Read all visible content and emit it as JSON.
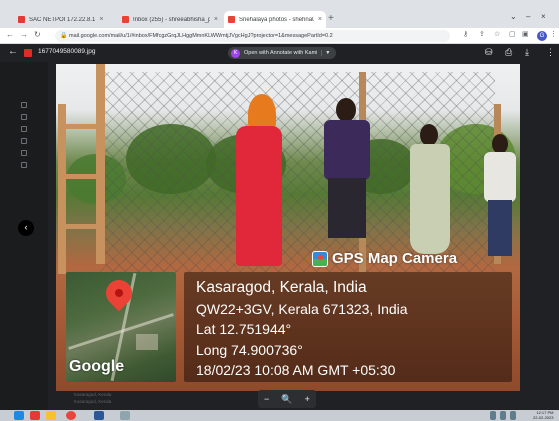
{
  "browser": {
    "tabs": [
      {
        "title": "SAC NETPOI   172.22.8.1",
        "favicon_color": "#e53935"
      },
      {
        "title": "Inbox (255) - shreeabhisha_ponam",
        "favicon_color": "#ea4335"
      },
      {
        "title": "Snehalaya photos - shehna09@g",
        "favicon_color": "#ea4335"
      }
    ],
    "new_tab": "+",
    "address": "mail.google.com/mail/u/1/#inbox/FMfcgzGrqJLHggMmnKLWWmtjJVgcHgJ?projector=1&messagePartId=0.2",
    "profile_initial": "G"
  },
  "viewer": {
    "filename": "1677049580089.jpg",
    "open_with": "Open with Annotate with Kami",
    "open_with_icon": "K"
  },
  "photo": {
    "header": "GPS Map Camera",
    "map_logo": "Google",
    "location": "Kasaragod, Kerala, India",
    "plus_code": "QW22+3GV, Kerala 671323, India",
    "lat": "Lat 12.751944°",
    "long": "Long 74.900736°",
    "datetime": "18/02/23 10:08 AM GMT +05:30"
  },
  "zoom": {
    "out": "−",
    "fit": "🔍",
    "in": "+"
  },
  "background_text": [
    "Kasaragod, Kerala",
    "Kasaragod, Kerala"
  ],
  "taskbar": {
    "time": "12:17 PM",
    "date": "22-02-2023"
  }
}
